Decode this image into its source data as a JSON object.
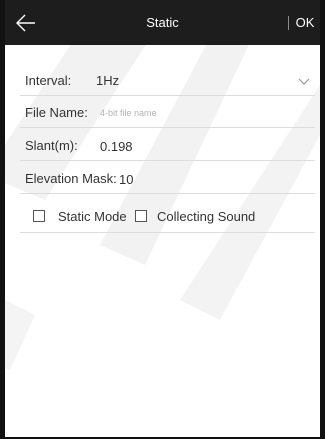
{
  "header": {
    "title": "Static",
    "ok_label": "OK",
    "back_icon": "arrow-left-icon",
    "background": "#1d1d1d"
  },
  "form": {
    "interval": {
      "label": "Interval:",
      "value": "1Hz",
      "icon": "chevron-down-icon"
    },
    "file_name": {
      "label": "File Name:",
      "value": "",
      "placeholder": "4-bit file name"
    },
    "slant": {
      "label": "Slant(m):",
      "value": "0.198"
    },
    "elevation_mask": {
      "label": "Elevation Mask:",
      "value": "10"
    },
    "static_mode": {
      "label": "Static Mode",
      "checked": false
    },
    "collecting_sound": {
      "label": "Collecting Sound",
      "checked": false
    }
  }
}
